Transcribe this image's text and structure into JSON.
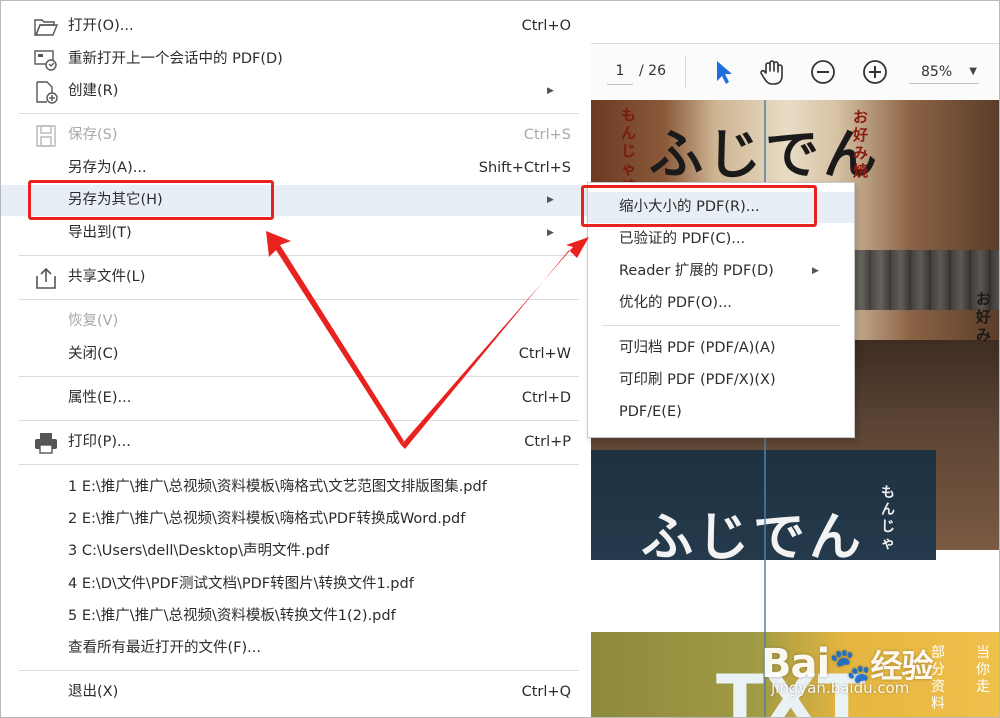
{
  "viewer": {
    "page_current": "1",
    "page_total": "/ 26",
    "zoom": "85%"
  },
  "doc": {
    "sign_top": "ふじでん",
    "sign_bottom": "ふじでん",
    "vert_left": "もんじゃ焼",
    "vert_right": "お好み焼",
    "vert_side": "お好み",
    "vert_noren": "もんじゃ",
    "big_text": "TXT",
    "vert_bottom_1": "部分资料",
    "vert_bottom_2": "当你走"
  },
  "menu": {
    "open": {
      "label": "打开(O)...",
      "shortcut": "Ctrl+O"
    },
    "reopen": {
      "label": "重新打开上一个会话中的 PDF(D)"
    },
    "create": {
      "label": "创建(R)"
    },
    "save": {
      "label": "保存(S)",
      "shortcut": "Ctrl+S"
    },
    "save_as": {
      "label": "另存为(A)...",
      "shortcut": "Shift+Ctrl+S"
    },
    "save_as_other": {
      "label": "另存为其它(H)"
    },
    "export_to": {
      "label": "导出到(T)"
    },
    "share": {
      "label": "共享文件(L)"
    },
    "revert": {
      "label": "恢复(V)"
    },
    "close": {
      "label": "关闭(C)",
      "shortcut": "Ctrl+W"
    },
    "properties": {
      "label": "属性(E)...",
      "shortcut": "Ctrl+D"
    },
    "print": {
      "label": "打印(P)...",
      "shortcut": "Ctrl+P"
    },
    "recent": [
      "1 E:\\推广\\推广\\总视频\\资料模板\\嗨格式\\文艺范图文排版图集.pdf",
      "2 E:\\推广\\推广\\总视频\\资料模板\\嗨格式\\PDF转换成Word.pdf",
      "3 C:\\Users\\dell\\Desktop\\声明文件.pdf",
      "4 E:\\D\\文件\\PDF测试文档\\PDF转图片\\转换文件1.pdf",
      "5 E:\\推广\\推广\\总视频\\资料模板\\转换文件1(2).pdf"
    ],
    "view_all_recent": {
      "label": "查看所有最近打开的文件(F)..."
    },
    "exit": {
      "label": "退出(X)",
      "shortcut": "Ctrl+Q"
    }
  },
  "submenu": {
    "items": [
      "缩小大小的 PDF(R)...",
      "已验证的 PDF(C)...",
      "Reader 扩展的 PDF(D)",
      "优化的 PDF(O)...",
      "可归档 PDF (PDF/A)(A)",
      "可印刷 PDF (PDF/X)(X)",
      "PDF/E(E)"
    ]
  },
  "watermark": {
    "logo": "Bai",
    "logo_cn": "经验",
    "url": "jingyan.baidu.com"
  },
  "colors": {
    "highlight": "#e8eef5",
    "annotation_red": "#e8231f",
    "cursor_blue": "#1e6fd9"
  }
}
